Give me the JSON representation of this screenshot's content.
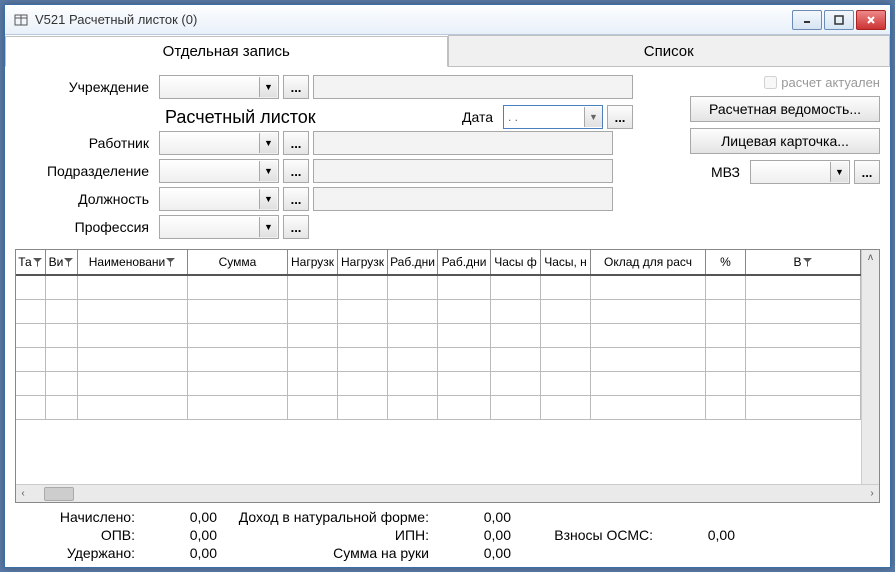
{
  "window": {
    "title": "V521 Расчетный листок (0)"
  },
  "tabs": {
    "single": "Отдельная запись",
    "list": "Список"
  },
  "labels": {
    "institution": "Учреждение",
    "section_title": "Расчетный листок",
    "date": "Дата",
    "date_placeholder": " .  .",
    "employee": "Работник",
    "department": "Подразделение",
    "position": "Должность",
    "profession": "Профессия",
    "mvz": "МВЗ"
  },
  "checkbox": {
    "calc_actual": "расчет актуален"
  },
  "buttons": {
    "payroll_sheet": "Расчетная ведомость...",
    "personal_card": "Лицевая карточка...",
    "dots": "..."
  },
  "grid": {
    "headers": [
      "Та",
      "Ви",
      "Наименовани",
      "Сумма",
      "Нагрузк",
      "Нагрузк",
      "Раб.дни",
      "Раб.дни",
      "Часы ф",
      "Часы, н",
      "Оклад для расч",
      "%",
      "В"
    ]
  },
  "summary": {
    "accrued_lbl": "Начислено:",
    "accrued_val": "0,00",
    "opv_lbl": "ОПВ:",
    "opv_val": "0,00",
    "withheld_lbl": "Удержано:",
    "withheld_val": "0,00",
    "income_kind_lbl": "Доход в натуральной форме:",
    "income_kind_val": "0,00",
    "ipn_lbl": "ИПН:",
    "ipn_val": "0,00",
    "net_lbl": "Сумма на руки",
    "net_val": "0,00",
    "osms_lbl": "Взносы ОСМС:",
    "osms_val": "0,00"
  }
}
